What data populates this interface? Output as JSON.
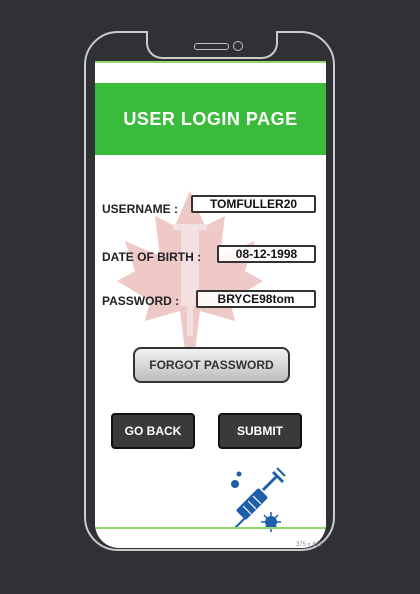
{
  "header": {
    "title": "USER LOGIN PAGE"
  },
  "form": {
    "username": {
      "label": "USERNAME :",
      "value": "TOMFULLER20"
    },
    "dob": {
      "label": "DATE OF BIRTH :",
      "value": "08-12-1998"
    },
    "password": {
      "label": "PASSWORD :",
      "value": "BRYCE98tom"
    }
  },
  "buttons": {
    "forgot": "FORGOT PASSWORD",
    "back": "GO BACK",
    "submit": "SUBMIT"
  },
  "footer": {
    "device_size": "375 x 812"
  },
  "colors": {
    "background": "#2f3134",
    "header_green": "#3bbb3b",
    "accent_line": "#8fd870",
    "button_dark": "#3a3a3a",
    "logo_blue": "#1f5fa8",
    "watermark_red": "#e8b3b3"
  },
  "icons": {
    "watermark": "maple-leaf-syringe-icon",
    "logo": "vaccine-syringe-icon"
  }
}
